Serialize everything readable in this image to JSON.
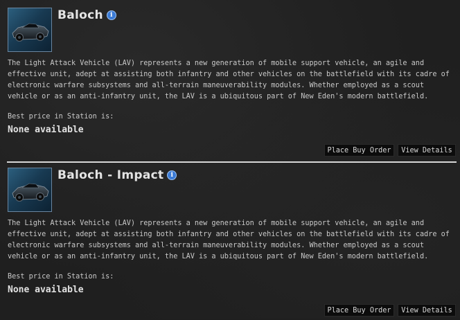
{
  "items": [
    {
      "title": "Baloch",
      "info_glyph": "i",
      "description": "The Light Attack Vehicle (LAV) represents a new generation of mobile support vehicle, an agile and effective unit, adept at assisting both infantry and other vehicles on the battlefield with its cadre of electronic warfare subsystems and all-terrain maneuverability modules. Whether employed as a scout vehicle or as an anti-infantry unit, the LAV is a ubiquitous part of New Eden's modern battlefield.",
      "best_price_label": "Best price in Station is:",
      "best_price_value": "None available",
      "buy_label": "Place Buy Order",
      "details_label": "View Details",
      "icon": "vehicle-thumbnail"
    },
    {
      "title": "Baloch - Impact",
      "info_glyph": "i",
      "description": "The Light Attack Vehicle (LAV) represents a new generation of mobile support vehicle, an agile and effective unit, adept at assisting both infantry and other vehicles on the battlefield with its cadre of electronic warfare subsystems and all-terrain maneuverability modules. Whether employed as a scout vehicle or as an anti-infantry unit, the LAV is a ubiquitous part of New Eden's modern battlefield.",
      "best_price_label": "Best price in Station is:",
      "best_price_value": "None available",
      "buy_label": "Place Buy Order",
      "details_label": "View Details",
      "icon": "vehicle-thumbnail"
    }
  ],
  "colors": {
    "background": "#1f1f1f",
    "info_icon": "#3b7bd6",
    "button_bg": "#0c0c0c",
    "divider": "#d8d8d8"
  }
}
